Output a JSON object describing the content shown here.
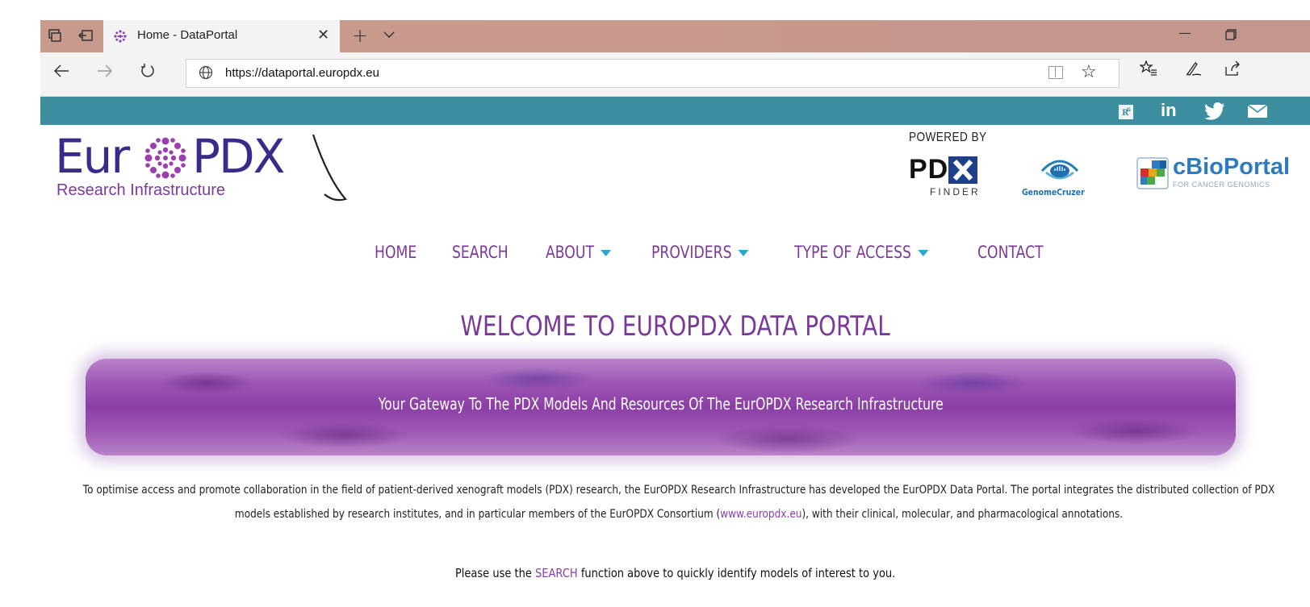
{
  "browser": {
    "tab_title": "Home - DataPortal",
    "tab_icons": [
      "tab-preview-icon",
      "set-aside-tabs-icon",
      "europdx-favicon"
    ],
    "url": "https://dataportal.europdx.eu",
    "nav_icons": [
      "back-arrow-icon",
      "forward-arrow-icon",
      "refresh-icon"
    ],
    "toolbar_icons": [
      "reading-view-icon",
      "favorite-star-icon",
      "favorites-list-icon",
      "web-note-pen-icon",
      "share-icon"
    ],
    "window_controls": [
      "minimize-icon",
      "restore-icon"
    ]
  },
  "topbar": {
    "color": "#3c8e9f",
    "social_icons": [
      "researchgate-icon",
      "linkedin-icon",
      "twitter-icon",
      "email-icon"
    ],
    "linkedin_label": "in"
  },
  "logo": {
    "main_left": "Eur",
    "main_right": "PDX",
    "subtitle": "Research Infrastructure"
  },
  "powered": {
    "label": "POWERED BY",
    "pdx_finder_main": "PD",
    "pdx_finder_sub": "FINDER",
    "genome_cruzer": "GenomeCruzer",
    "cbioportal": "cBioPortal",
    "cbioportal_sub": "FOR CANCER GENOMICS"
  },
  "menu": {
    "home": "HOME",
    "search": "SEARCH",
    "about": "ABOUT",
    "providers": "PROVIDERS",
    "type_of_access": "TYPE OF ACCESS",
    "contact": "CONTACT"
  },
  "welcome": "WELCOME TO EUROPDX DATA PORTAL",
  "banner": "Your Gateway To The PDX Models And Resources Of The EurOPDX Research Infrastructure",
  "intro": {
    "part1": "To optimise access and promote collaboration in the field of patient-derived xenograft models (PDX) research, the EurOPDX Research Infrastructure has developed the EurOPDX Data Portal. The portal integrates the distributed collection of PDX models established by research institutes, and in particular members of the EurOPDX Consortium (",
    "link": "www.europdx.eu",
    "part2": "), with their clinical, molecular, and pharmacological annotations."
  },
  "search_line": {
    "before": "Please use the ",
    "link": "SEARCH",
    "after": " function above to quickly identify models of interest to you."
  },
  "colors": {
    "brand_purple": "#7b3a9a",
    "logo_navy": "#3c2a8a",
    "accent_cyan": "#29a8d6",
    "tab_strip": "#c89a8c"
  }
}
